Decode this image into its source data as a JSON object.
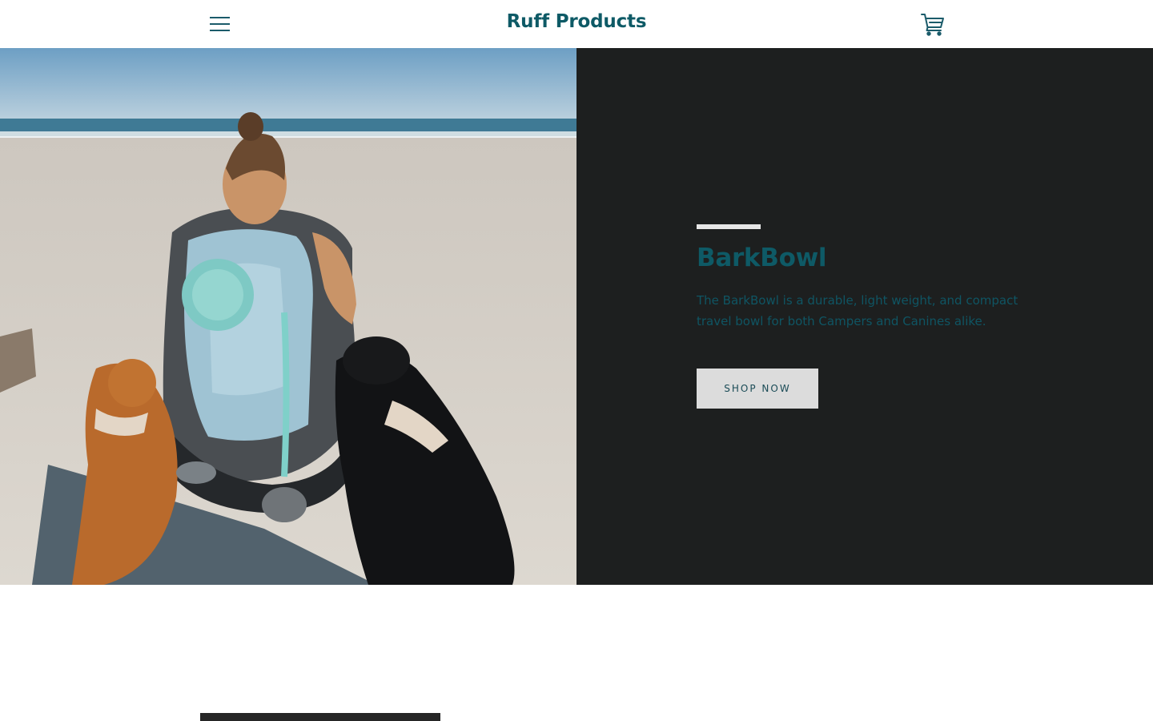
{
  "header": {
    "logo": "Ruff Products",
    "menu_icon": "hamburger-menu-icon",
    "cart_icon": "shopping-cart-icon"
  },
  "hero": {
    "title": "BarkBowl",
    "description": "The BarkBowl is a durable, light weight, and compact travel bowl for both Campers and Canines alike.",
    "cta_label": "SHOP NOW",
    "image_subject": "woman with backpack and two dogs sitting on a beach"
  },
  "colors": {
    "brand": "#0e5a66",
    "panel_bg": "#1d1f1f",
    "button_bg": "#dcdcdc"
  }
}
